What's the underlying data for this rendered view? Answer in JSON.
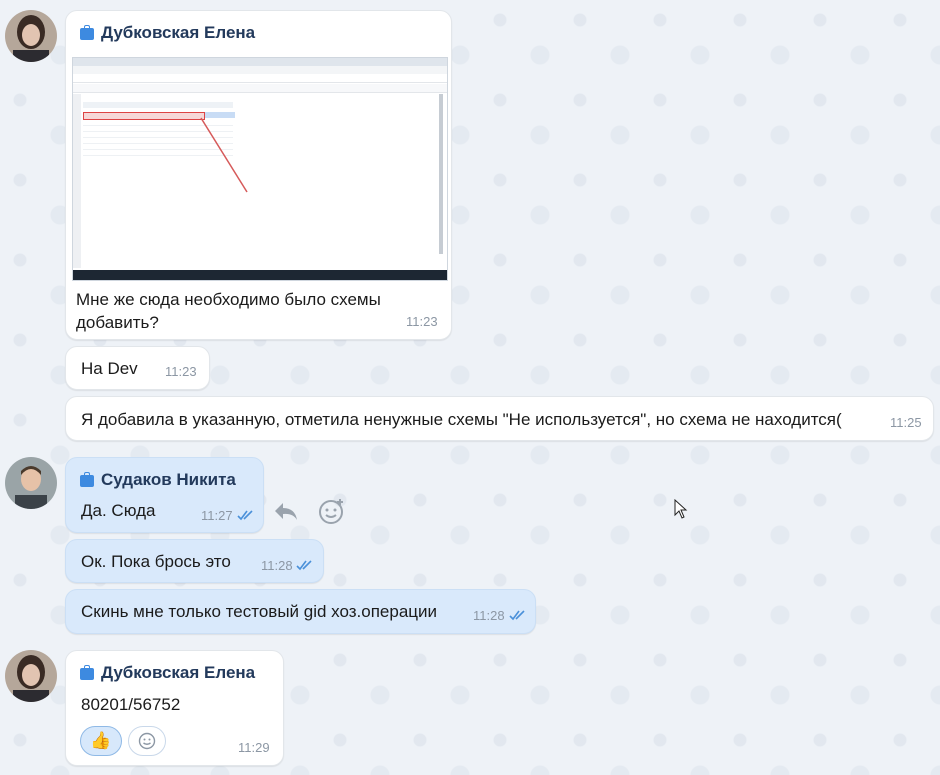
{
  "messages": [
    {
      "sender": "Дубковская Елена",
      "attachment": "screenshot-image",
      "text_line1": "Мне же сюда необходимо было схемы",
      "text_line2": "добавить?",
      "time": "11:23"
    },
    {
      "text": "На Dev",
      "time": "11:23"
    },
    {
      "text": "Я добавила в указанную, отметила ненужные схемы \"Не используется\", но схема не находится(",
      "time": "11:25"
    },
    {
      "sender": "Судаков Никита",
      "text": "Да. Сюда",
      "time": "11:27",
      "status": "read"
    },
    {
      "text": "Ок. Пока брось это",
      "time": "11:28",
      "status": "read"
    },
    {
      "text": "Скинь мне только тестовый gid хоз.операции",
      "time": "11:28",
      "status": "read"
    },
    {
      "sender": "Дубковская Елена",
      "text": "80201/56752",
      "time": "11:29",
      "reactions": [
        "👍"
      ]
    }
  ],
  "colors": {
    "incoming_bubble": "#ffffff",
    "outgoing_bubble": "#d9e9fb",
    "sender_name": "#233a5c",
    "accent": "#3d8ae0"
  },
  "icons": {
    "reply": "reply-icon",
    "add_reaction": "smile-plus-icon",
    "read_status": "double-check-icon",
    "sender_badge": "briefcase-icon"
  }
}
